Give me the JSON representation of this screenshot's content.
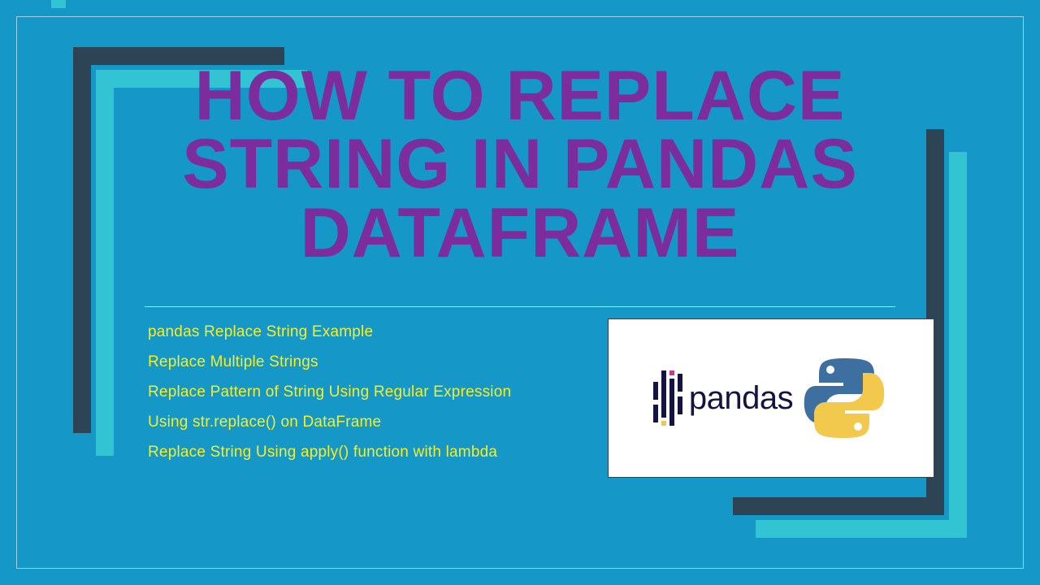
{
  "title": "HOW TO REPLACE STRING IN PANDAS DATAFRAME",
  "bullets": [
    "pandas Replace String Example",
    "Replace Multiple Strings",
    "Replace Pattern of String Using Regular Expression",
    " Using str.replace() on DataFrame",
    "Replace String Using apply() function with lambda"
  ],
  "logo": {
    "word": "pandas"
  },
  "colors": {
    "background": "#1597C7",
    "title": "#7C2C9C",
    "bullet": "#F4EF2B",
    "bracket_dark": "#2D4455",
    "bracket_cyan": "#33C4D4"
  }
}
